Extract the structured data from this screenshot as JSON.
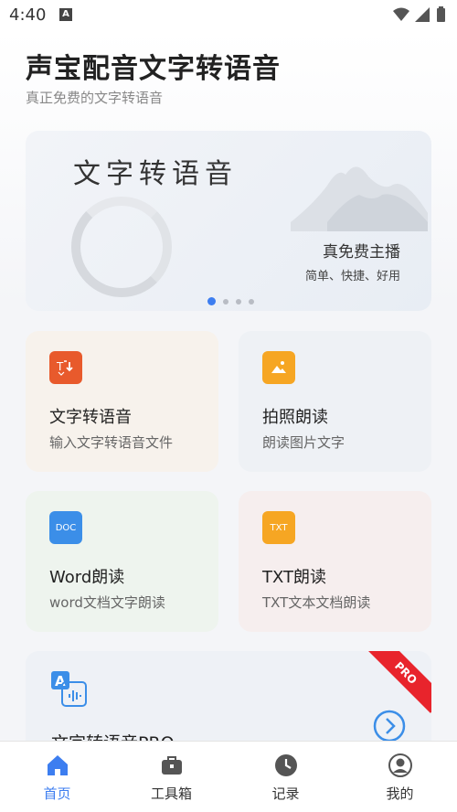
{
  "status_bar": {
    "time": "4:40",
    "notif_letter": "A"
  },
  "header": {
    "title": "声宝配音文字转语音",
    "subtitle": "真正免费的文字转语音"
  },
  "banner": {
    "heading": "文字转语音",
    "tagline": "真免费主播",
    "sub": "简单、快捷、好用",
    "page_count": 4,
    "active_index": 0
  },
  "features": [
    {
      "title": "文字转语音",
      "desc": "输入文字转语音文件",
      "icon": "text-to-speech-icon",
      "color": "#e85a2c"
    },
    {
      "title": "拍照朗读",
      "desc": "朗读图片文字",
      "icon": "image-icon",
      "color": "#f6a623"
    },
    {
      "title": "Word朗读",
      "desc": "word文档文字朗读",
      "icon": "doc-icon",
      "icon_text": "DOC",
      "color": "#3b8ee8"
    },
    {
      "title": "TXT朗读",
      "desc": "TXT文本文档朗读",
      "icon": "txt-icon",
      "icon_text": "TXT",
      "color": "#f6a623"
    }
  ],
  "pro": {
    "title": "文字转语音PRO",
    "badge": "PRO"
  },
  "tabs": [
    {
      "label": "首页",
      "icon": "home-icon",
      "active": true
    },
    {
      "label": "工具箱",
      "icon": "toolbox-icon",
      "active": false
    },
    {
      "label": "记录",
      "icon": "clock-icon",
      "active": false
    },
    {
      "label": "我的",
      "icon": "user-icon",
      "active": false
    }
  ],
  "colors": {
    "accent": "#3d7ef0",
    "pro_ribbon": "#e8242c"
  }
}
